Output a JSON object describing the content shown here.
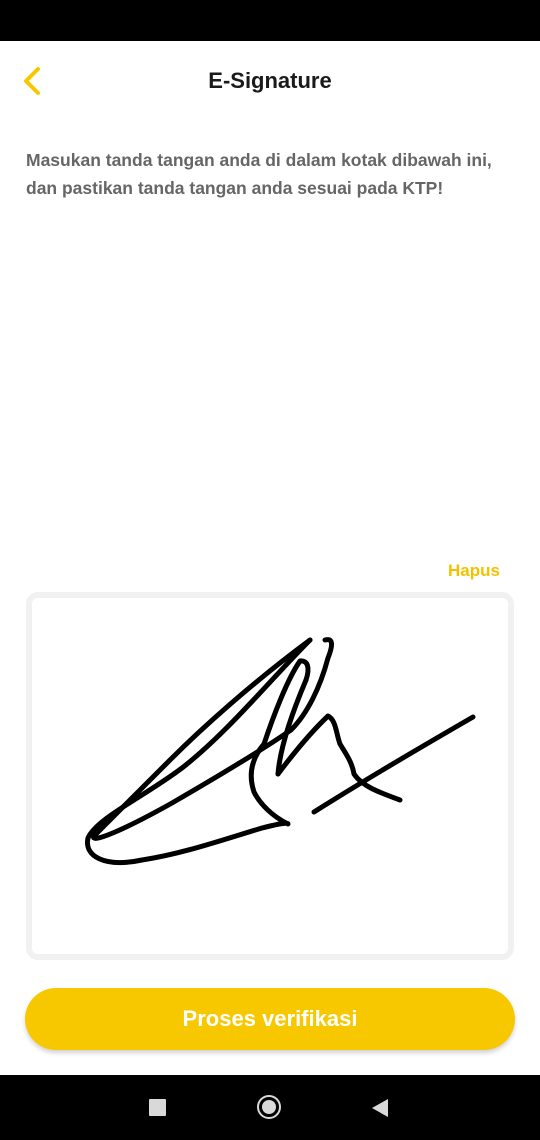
{
  "header": {
    "title": "E-Signature",
    "back_icon": "chevron-left-icon"
  },
  "instruction_text": "Masukan tanda tangan anda di dalam kotak dibawah ini, dan pastikan tanda tangan anda sesuai pada KTP!",
  "signature_pad": {
    "clear_label": "Hapus"
  },
  "submit_button": {
    "label": "Proses verifikasi"
  },
  "nav_bar": {
    "recents_icon": "square-icon",
    "home_icon": "circle-icon",
    "back_icon": "triangle-back-icon"
  },
  "colors": {
    "accent": "#f7c800",
    "accent_text": "#f2c200",
    "title_text": "#1a1a1a",
    "body_text": "#666666",
    "pad_border": "#f1f1f1"
  }
}
